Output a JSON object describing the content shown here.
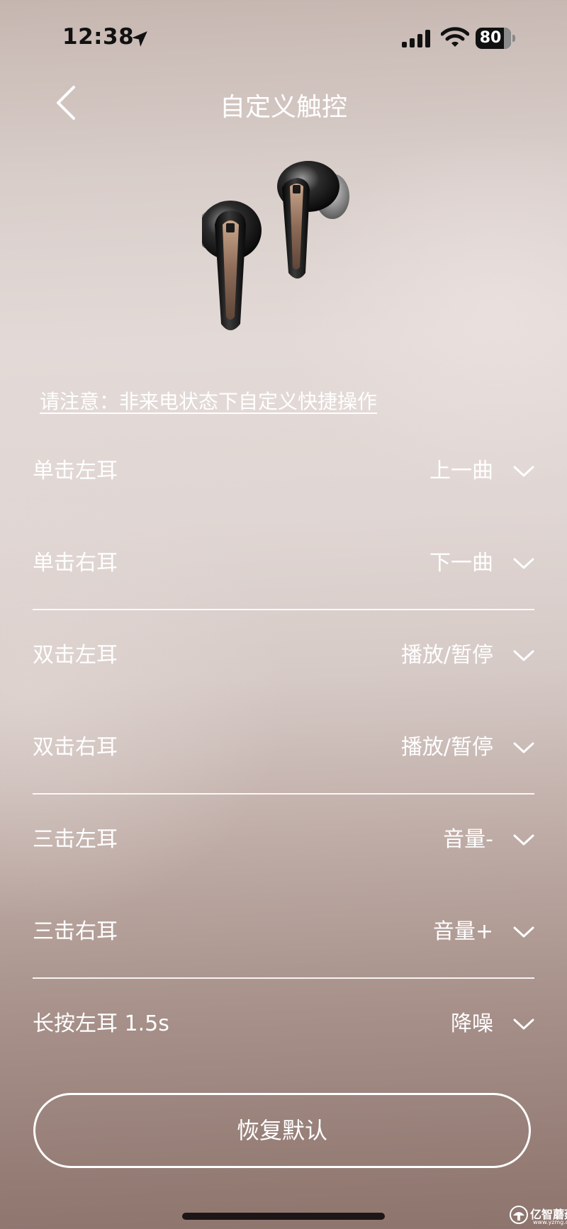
{
  "status_bar": {
    "time": "12:38",
    "battery_level": 80,
    "battery_text": "80"
  },
  "header": {
    "title": "自定义触控",
    "back_icon": "chevron-left-icon"
  },
  "product": {
    "image_icon": "earbuds-image"
  },
  "notice": "请注意：非来电状态下自定义快捷操作",
  "settings": [
    {
      "label": "单击左耳",
      "value": "上一曲"
    },
    {
      "label": "单击右耳",
      "value": "下一曲"
    },
    {
      "label": "双击左耳",
      "value": "播放/暂停"
    },
    {
      "label": "双击右耳",
      "value": "播放/暂停"
    },
    {
      "label": "三击左耳",
      "value": "音量-"
    },
    {
      "label": "三击右耳",
      "value": "音量+"
    },
    {
      "label": "长按左耳 1.5s",
      "value": "降噪"
    }
  ],
  "reset_label": "恢复默认",
  "watermark": {
    "text": "亿智蘑菇",
    "sub": "www.yzmg.com"
  }
}
